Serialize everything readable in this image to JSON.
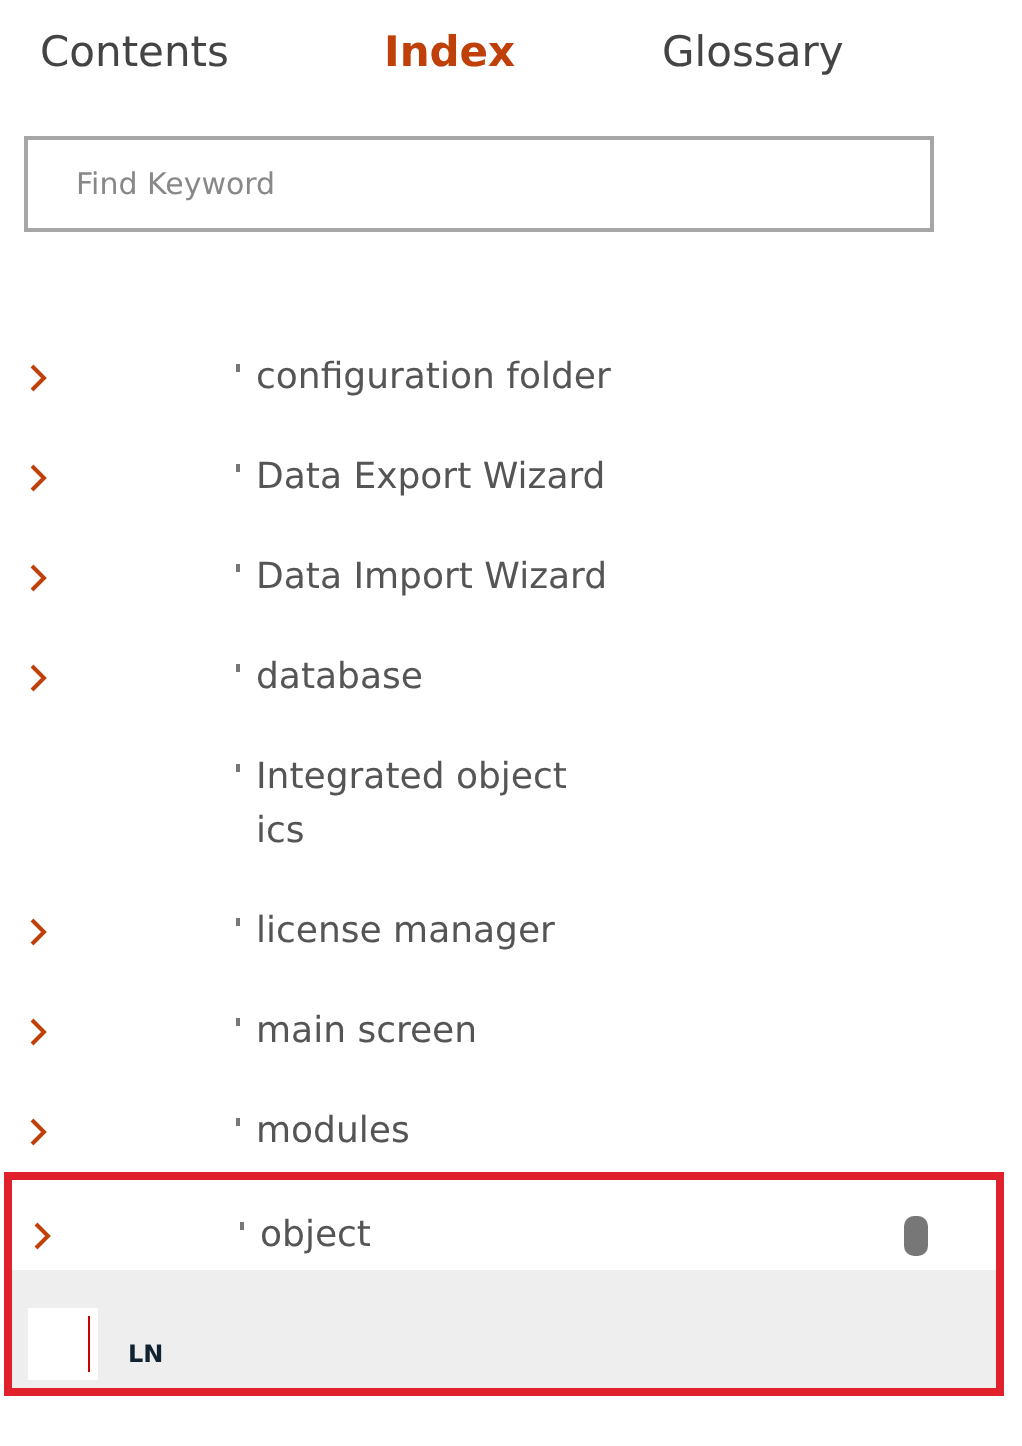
{
  "tabs": [
    {
      "label": "Contents",
      "selected": false
    },
    {
      "label": "Index",
      "selected": true
    },
    {
      "label": "Glossary",
      "selected": false
    }
  ],
  "search": {
    "placeholder": "Find Keyword"
  },
  "entries": [
    {
      "lines": [
        "configuration folder"
      ],
      "expandable": true,
      "highlighted": false
    },
    {
      "lines": [
        "Data Export Wizard"
      ],
      "expandable": true,
      "highlighted": false
    },
    {
      "lines": [
        "Data Import Wizard"
      ],
      "expandable": true,
      "highlighted": false
    },
    {
      "lines": [
        "database"
      ],
      "expandable": true,
      "highlighted": false
    },
    {
      "lines": [
        "Integrated object",
        "ics"
      ],
      "expandable": false,
      "highlighted": false
    },
    {
      "lines": [
        "license manager"
      ],
      "expandable": true,
      "highlighted": false
    },
    {
      "lines": [
        "main screen"
      ],
      "expandable": true,
      "highlighted": false
    },
    {
      "lines": [
        "modules"
      ],
      "expandable": true,
      "highlighted": false
    },
    {
      "lines": [
        "object"
      ],
      "expandable": true,
      "highlighted": true
    }
  ],
  "footer": {
    "label": "LN"
  }
}
